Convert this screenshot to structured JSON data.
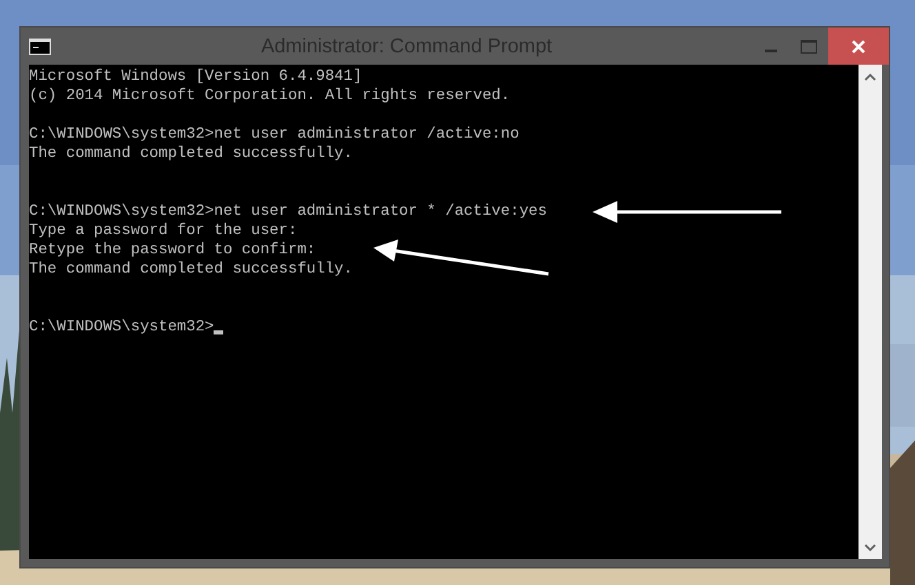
{
  "window": {
    "title": "Administrator: Command Prompt"
  },
  "console": {
    "lines": [
      {
        "kind": "output",
        "text": "Microsoft Windows [Version 6.4.9841]"
      },
      {
        "kind": "output",
        "text": "(c) 2014 Microsoft Corporation. All rights reserved."
      },
      {
        "kind": "blank"
      },
      {
        "kind": "prompt",
        "text": "C:\\WINDOWS\\system32>net user administrator /active:no"
      },
      {
        "kind": "output",
        "text": "The command completed successfully."
      },
      {
        "kind": "blank"
      },
      {
        "kind": "blank"
      },
      {
        "kind": "prompt",
        "text": "C:\\WINDOWS\\system32>net user administrator * /active:yes"
      },
      {
        "kind": "output",
        "text": "Type a password for the user:"
      },
      {
        "kind": "output",
        "text": "Retype the password to confirm:"
      },
      {
        "kind": "output",
        "text": "The command completed successfully."
      },
      {
        "kind": "blank"
      },
      {
        "kind": "blank"
      },
      {
        "kind": "prompt",
        "text": "C:\\WINDOWS\\system32>",
        "cursor": true
      }
    ]
  }
}
